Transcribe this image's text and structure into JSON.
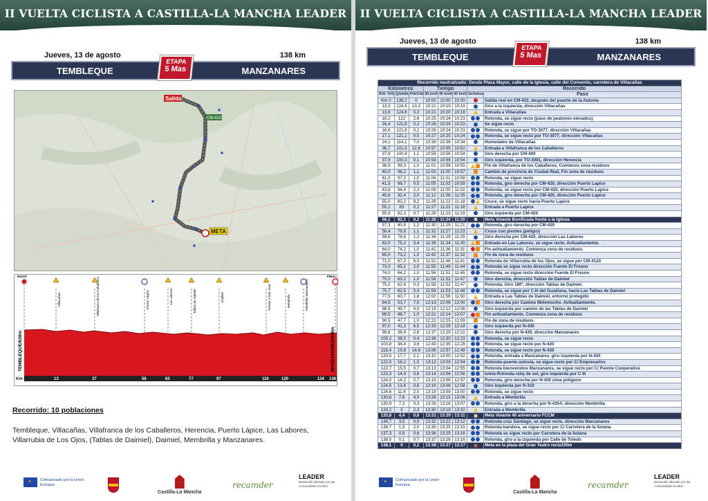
{
  "banner_title": "II VUELTA CICLISTA A CASTILLA-LA MANCHA LEADER",
  "stage": {
    "date": "Jueves, 13 de agosto",
    "distance": "138 km",
    "from": "TEMBLEQUE",
    "to": "MANZANARES",
    "etapa_label": "ETAPA",
    "etapa_value": "5 Mas"
  },
  "map": {
    "start_label": "Salida",
    "finish_label": "META",
    "road_label": "CM-410",
    "places": [
      "Villacañas",
      "Villafranca de los Caballeros",
      "Herencia",
      "Puerto Lápice",
      "Las Labores",
      "Daimiel",
      "Membrilla",
      "Manzanares"
    ]
  },
  "profile": {
    "start_label": "INICIO",
    "end_label": "FINAL",
    "left_axis": "TEMBLEQUE/638m",
    "right_axis": "MANZANARES/648m",
    "km_label": "Km 0",
    "km_ticks": [
      "13",
      "37",
      "56",
      "63",
      "77",
      "97",
      "116",
      "120",
      "134",
      "138"
    ],
    "waypoints": [
      "Villacañas",
      "Villafranca de los Caballeros",
      "Puerto Lápice",
      "Las Labores",
      "Tablas de Daimiel",
      "Daimiel",
      "Arenas a San Juan",
      "Membrilla",
      "Membrilla Manzanares"
    ]
  },
  "recorrido": {
    "title": "Recorrido: 10 poblaciones",
    "text": "Tembleque, Villacañas, Villafranca de los Caballeros, Herencia, Puerto Lápice, Las Labores, Villarrubia de Los Ojos, (Tablas de Daimiel), Daimiel, Membrilla y Manzanares."
  },
  "footer": {
    "eu_text": "Cofinanciado por la Unión Europea",
    "clm_text": "Castilla-La Mancha",
    "recamder": "recamder",
    "leader": "LEADER",
    "leader_sub": "Desarrollo liderado por las comunidades locales"
  },
  "table": {
    "title": "Recorrido neutralizado: Desde Plaza Mayor, calle de la Iglesia, calle del Convento, carretera de Villacañas",
    "group_km": "Kilómetros",
    "group_time": "Tiempo",
    "group_route": "Recorrido",
    "col_total": "Km Total",
    "col_left": "Quedan",
    "col_partial": "Parcial",
    "col_38": "38 km/h",
    "col_40": "40 km/h",
    "col_42": "42 km/h",
    "col_signs": "Señalización",
    "col_route": "Paso",
    "rows": [
      {
        "t": "Km 0",
        "q": "138,2",
        "p": "0",
        "a": "10:00",
        "b": "10:00",
        "c": "10:00",
        "icons": [
          "red"
        ],
        "d": "Salida real en CM-410, después del puente de la Autovía"
      },
      {
        "t": "13,3",
        "q": "124,9",
        "p": "13,3",
        "a": "10:21",
        "b": "10:19",
        "c": "10:19",
        "icons": [
          "blue"
        ],
        "d": "Giro a la izquierda, dirección Villacañas"
      },
      {
        "t": "13,6",
        "q": "124,6",
        "p": "0,3",
        "a": "10:21",
        "b": "10:20",
        "c": "10:19",
        "icons": [
          "tri"
        ],
        "d": "Entrada a Villacañas"
      },
      {
        "t": "16,2",
        "q": "122",
        "p": "2,6",
        "a": "10:25",
        "b": "10:24",
        "c": "10:23",
        "icons": [
          "blue",
          "blue"
        ],
        "d": "Rotonda, se sigue recto (paso de peatones elevados)"
      },
      {
        "t": "16,4",
        "q": "121,8",
        "p": "0,2",
        "a": "10:26",
        "b": "10:24",
        "c": "10:23",
        "icons": [
          "blue"
        ],
        "d": "Se sigue recto"
      },
      {
        "t": "16,6",
        "q": "121,6",
        "p": "0,2",
        "a": "10:26",
        "b": "10:24",
        "c": "10:23",
        "icons": [
          "blue",
          "blue"
        ],
        "d": "Rotonda, se sigue por TO-3077, dirección Villacañas"
      },
      {
        "t": "17,1",
        "q": "121,1",
        "p": "0,5",
        "a": "10:27",
        "b": "10:25",
        "c": "10:24",
        "icons": [
          "blue",
          "blue"
        ],
        "d": "Rotonda, se sigue recto por TO-3077, dirección Villacañas"
      },
      {
        "t": "24,1",
        "q": "114,1",
        "p": "7,0",
        "a": "10:38",
        "b": "10:36",
        "c": "10:34",
        "icons": [
          "blue"
        ],
        "d": "Humedales de Villacañas"
      },
      {
        "t": "36,7",
        "q": "101,5",
        "p": "12,6",
        "a": "10:57",
        "b": "10:55",
        "c": "10:52",
        "icons": [
          "tri"
        ],
        "d": "Entrada a Villafranca de los Caballeros"
      },
      {
        "t": "37,8",
        "q": "100,4",
        "p": "1,1",
        "a": "10:59",
        "b": "10:56",
        "c": "10:54",
        "icons": [
          "blue"
        ],
        "d": "Giro derecha por CM-400"
      },
      {
        "t": "37,9",
        "q": "100,3",
        "p": "0,1",
        "a": "10:59",
        "b": "10:56",
        "c": "10:54",
        "icons": [
          "blue"
        ],
        "d": "Giro izquierda, por TO-3091, dirección Herencia"
      },
      {
        "t": "38,9",
        "q": "99,3",
        "p": "1,0",
        "a": "11:01",
        "b": "10:58",
        "c": "10:55",
        "icons": [
          "tri",
          "orange"
        ],
        "d": "Fin de Villafranca de los Caballeros, Comienzo zona residuos"
      },
      {
        "t": "40,0",
        "q": "98,2",
        "p": "1,1",
        "a": "11:03",
        "b": "11:00",
        "c": "10:57",
        "icons": [
          "orange"
        ],
        "d": "Cambio de provincia de Ciudad Real, Fin zona de residuos"
      },
      {
        "t": "41,0",
        "q": "97,2",
        "p": "1,0",
        "a": "11:04",
        "b": "11:01",
        "c": "10:58",
        "icons": [
          "blue",
          "blue"
        ],
        "d": "Rotonda, se sigue recto"
      },
      {
        "t": "41,5",
        "q": "96,7",
        "p": "0,5",
        "a": "11:05",
        "b": "11:02",
        "c": "10:59",
        "icons": [
          "blue",
          "blue"
        ],
        "d": "Rotonda, giro derecha por CM-420, dirección Puerto Lapice"
      },
      {
        "t": "43,8",
        "q": "94,4",
        "p": "2,3",
        "a": "11:09",
        "b": "11:05",
        "c": "11:02",
        "icons": [
          "blue",
          "blue"
        ],
        "d": "Rotonda, se sigue recto por CM-420, dirección Puerto Lapice"
      },
      {
        "t": "45,8",
        "q": "92,4",
        "p": "2,0",
        "a": "11:12",
        "b": "11:08",
        "c": "11:05",
        "icons": [
          "blue",
          "blue"
        ],
        "d": "Rotonda, giro derecha por CM-420, dirección Puerto Lapice"
      },
      {
        "t": "55,0",
        "q": "83,2",
        "p": "9,2",
        "a": "11:26",
        "b": "11:22",
        "c": "11:18",
        "icons": [
          "blue",
          "tri"
        ],
        "d": "Cruce, se sigue recto hacia Puerto Lapice"
      },
      {
        "t": "55,2",
        "q": "83",
        "p": "0,2",
        "a": "11:27",
        "b": "11:22",
        "c": "11:18",
        "icons": [
          "tri"
        ],
        "d": "Entrada a Puerto Lapice"
      },
      {
        "t": "55,9",
        "q": "82,3",
        "p": "0,7",
        "a": "11:28",
        "b": "11:23",
        "c": "11:19",
        "icons": [
          "blue"
        ],
        "d": "Giro izquierda por CM-420"
      },
      {
        "t": "56,1",
        "q": "82,1",
        "p": "0,2",
        "a": "11:28",
        "b": "11:24",
        "c": "11:20",
        "icons": [
          "cam"
        ],
        "d": "Meta Volante Bonificada frente a la Iglesia",
        "hl": true
      },
      {
        "t": "57,3",
        "q": "80,9",
        "p": "1,2",
        "a": "11:30",
        "b": "11:25",
        "c": "11:21",
        "icons": [
          "blue",
          "blue"
        ],
        "d": "Rotonda, giro derecha por CM-420"
      },
      {
        "t": "58,4",
        "q": "79,8",
        "p": "1,1",
        "a": "11:32",
        "b": "11:27",
        "c": "11:23",
        "icons": [
          "tri"
        ],
        "d": "Cruce con pivotes (peligro)"
      },
      {
        "t": "59,6",
        "q": "78,6",
        "p": "1,2",
        "a": "11:34",
        "b": "11:29",
        "c": "11:25",
        "icons": [
          "blue"
        ],
        "d": "Giro derecha por CM-420, dirección Las Labores"
      },
      {
        "t": "63,0",
        "q": "75,2",
        "p": "3,4",
        "a": "11:39",
        "b": "11:34",
        "c": "11:30",
        "icons": [
          "tri",
          "orange"
        ],
        "d": "Entrada en Las Labores, se sigue recto. Avituallamiento."
      },
      {
        "t": "64,0",
        "q": "74,2",
        "p": "1,0",
        "a": "11:41",
        "b": "11:36",
        "c": "11:31",
        "icons": [
          "red",
          "orange"
        ],
        "d": "Fin avituallamiento. Comienza zona de residuos."
      },
      {
        "t": "65,0",
        "q": "73,2",
        "p": "1,0",
        "a": "11:42",
        "b": "11:37",
        "c": "11:32",
        "icons": [
          "orange"
        ],
        "d": "Fin de zona de residuos"
      },
      {
        "t": "71,0",
        "q": "67,2",
        "p": "6,0",
        "a": "11:52",
        "b": "11:46",
        "c": "11:41",
        "icons": [
          "blue",
          "blue"
        ],
        "d": "Rotonda de Villarrubia de los Ojos, se sigue por CM-4120"
      },
      {
        "t": "73,0",
        "q": "65,2",
        "p": "2,0",
        "a": "11:55",
        "b": "11:49",
        "c": "11:44",
        "icons": [
          "blue",
          "blue"
        ],
        "d": "Rotonda se sigue recto dirección Fuente El Fresno"
      },
      {
        "t": "74,0",
        "q": "64,2",
        "p": "1,0",
        "a": "11:56",
        "b": "11:51",
        "c": "11:45",
        "icons": [
          "blue",
          "blue"
        ],
        "d": "Rotonda, se sigue recto dirección Fuente El Fresno"
      },
      {
        "t": "75,0",
        "q": "63,2",
        "p": "1,0",
        "a": "11:58",
        "b": "11:52",
        "c": "11:47",
        "icons": [
          "blue"
        ],
        "d": "Giro derecha, dirección Tablas de Daimiel"
      },
      {
        "t": "75,2",
        "q": "62,9",
        "p": "0,3",
        "a": "11:58",
        "b": "11:52",
        "c": "11:47",
        "icons": [
          "blue"
        ],
        "d": "Rotonda, Giro 180º, dirección Tablas de Daimiel."
      },
      {
        "t": "75,7",
        "q": "62,5",
        "p": "0,4",
        "a": "11:59",
        "b": "11:53",
        "c": "11:48",
        "icons": [
          "blue",
          "blue"
        ],
        "d": "Rotonda, se sigue por C.N del Guadiana, hacia Las Tablas de Daimiel"
      },
      {
        "t": "77,5",
        "q": "60,7",
        "p": "1,8",
        "a": "12:02",
        "b": "11:56",
        "c": "11:50",
        "icons": [
          "tri"
        ],
        "d": "Entrada a Las Tablas de Daimiel, entorno protegido"
      },
      {
        "t": "84,5",
        "q": "53,7",
        "p": "7,0",
        "a": "12:13",
        "b": "12:06",
        "c": "12:00",
        "icons": [
          "blue",
          "orange"
        ],
        "d": "Giro derecha por Camino Molemocho. Avituallamiento."
      },
      {
        "t": "88,5",
        "q": "49,7",
        "p": "4,0",
        "a": "12:19",
        "b": "12:12",
        "c": "12:06",
        "icons": [
          "blue"
        ],
        "d": "Giro izquierda por camino de las Tablas de Daimiel"
      },
      {
        "t": "89,5",
        "q": "48,7",
        "p": "1,0",
        "a": "12:21",
        "b": "12:14",
        "c": "12:07",
        "icons": [
          "red",
          "orange"
        ],
        "d": "Fin avituallamiento. Comienza zona de residuos"
      },
      {
        "t": "90,5",
        "q": "47,7",
        "p": "1,0",
        "a": "12:22",
        "b": "12:15",
        "c": "12:09",
        "icons": [
          "orange"
        ],
        "d": "Fin de zona de residuos"
      },
      {
        "t": "97,0",
        "q": "41,2",
        "p": "6,5",
        "a": "12:33",
        "b": "12:25",
        "c": "12:18",
        "icons": [
          "blue"
        ],
        "d": "Giro izquierda por N-430"
      },
      {
        "t": "99,8",
        "q": "38,4",
        "p": "2,8",
        "a": "12:37",
        "b": "12:29",
        "c": "12:22",
        "icons": [
          "blue"
        ],
        "d": "Giro derecha por N-430, dirección Manzanares"
      },
      {
        "t": "100,2",
        "q": "38,0",
        "p": "0,4",
        "a": "12:38",
        "b": "12:30",
        "c": "12:23",
        "icons": [
          "blue",
          "blue"
        ],
        "d": "Rotonda, se sigue recto"
      },
      {
        "t": "103,8",
        "q": "34,4",
        "p": "3,6",
        "a": "12:43",
        "b": "12:35",
        "c": "12:28",
        "icons": [
          "blue",
          "blue"
        ],
        "d": "Rotonda, se sigue recto por N-430"
      },
      {
        "t": "118,4",
        "q": "19,8",
        "p": "14,6",
        "a": "13:06",
        "b": "12:57",
        "c": "12:49",
        "icons": [
          "blue",
          "blue"
        ],
        "d": "Rotonda, se sigue recto por N-430"
      },
      {
        "t": "120,5",
        "q": "17,7",
        "p": "2,1",
        "a": "13:10",
        "b": "13:00",
        "c": "12:52",
        "icons": [
          "blue",
          "blue"
        ],
        "d": "Rotonda, entrada a Manzanares, giro izquierda por N-430"
      },
      {
        "t": "122,0",
        "q": "16,2",
        "p": "1,5",
        "a": "13:12",
        "b": "13:03",
        "c": "12:54",
        "icons": [
          "blue",
          "blue"
        ],
        "d": "Rotonda-puente autovía, se sigue recto por C/ Empresarios"
      },
      {
        "t": "122,7",
        "q": "15,5",
        "p": "0,7",
        "a": "13:13",
        "b": "13:04",
        "c": "12:55",
        "icons": [
          "blue",
          "blue"
        ],
        "d": "Rotonda bienvenidos Manzanares, se sigue recto por C/ Puente Cooperativa"
      },
      {
        "t": "123,3",
        "q": "14,9",
        "p": "0,6",
        "a": "13:14",
        "b": "13:04",
        "c": "12:56",
        "icons": [
          "blue",
          "blue"
        ],
        "d": "Isleta-Rotonda reloj de sol, giro izquierda por C III"
      },
      {
        "t": "124,0",
        "q": "14,2",
        "p": "0,7",
        "a": "13:15",
        "b": "13:06",
        "c": "12:57",
        "icons": [
          "blue",
          "blue"
        ],
        "d": "Rotonda, giro derecha por N-430 zona polígono"
      },
      {
        "t": "124,6",
        "q": "13,6",
        "p": "0,6",
        "a": "13:16",
        "b": "13:06",
        "c": "12:58",
        "icons": [
          "blue"
        ],
        "d": "Giro Izquierda por N-310"
      },
      {
        "t": "126,6",
        "q": "11,6",
        "p": "2,0",
        "a": "13:19",
        "b": "13:09",
        "c": "13:00",
        "icons": [
          "blue",
          "blue"
        ],
        "d": "Rotonda, se sigue recto"
      },
      {
        "t": "130,6",
        "q": "7,6",
        "p": "4,0",
        "a": "13:26",
        "b": "13:15",
        "c": "13:06",
        "icons": [
          "tri"
        ],
        "d": "Entrada a Membrilla"
      },
      {
        "t": "130,9",
        "q": "7,3",
        "p": "0,3",
        "a": "13:26",
        "b": "13:16",
        "c": "13:07",
        "icons": [
          "blue",
          "blue"
        ],
        "d": "Rotonda, giro a la derecha por N-430A, dirección Membrilla"
      },
      {
        "t": "133,2",
        "q": "5",
        "p": "2,3",
        "a": "13:30",
        "b": "13:19",
        "c": "13:10",
        "icons": [
          "tri"
        ],
        "d": "Entrada a Membrilla"
      },
      {
        "t": "133,8",
        "q": "4,4",
        "p": "0,6",
        "a": "13:31",
        "b": "13:20",
        "c": "13:11",
        "icons": [
          "cam"
        ],
        "d": "Meta Volante 40 aniversario FCCM",
        "hl": true
      },
      {
        "t": "134,7",
        "q": "3,5",
        "p": "0,9",
        "a": "13:32",
        "b": "13:22",
        "c": "13:12",
        "icons": [
          "blue",
          "blue"
        ],
        "d": "Rotonda cruz Santiago, se sigue recto, dirección Manzanares"
      },
      {
        "t": "136,7",
        "q": "1,5",
        "p": "2,0",
        "a": "13:35",
        "b": "13:25",
        "c": "13:15",
        "icons": [
          "blue",
          "blue"
        ],
        "d": "Rotonda bandera, se sigue recto por C/ Carretera de la Solana"
      },
      {
        "t": "137,3",
        "q": "0,9",
        "p": "0,6",
        "a": "13:36",
        "b": "13:25",
        "c": "13:16",
        "icons": [
          "blue",
          "blue"
        ],
        "d": "Rotonda se sigue recto por Carretera de la Solana"
      },
      {
        "t": "138,0",
        "q": "0,1",
        "p": "0,7",
        "a": "13:37",
        "b": "13:26",
        "c": "13:16",
        "icons": [
          "blue",
          "blue"
        ],
        "d": "Rotonda, giro a la izquierda por Calle de Toledo"
      },
      {
        "t": "138,1",
        "q": "0",
        "p": "0,2",
        "a": "13:38",
        "b": "13:27",
        "c": "13:17",
        "icons": [
          "flag"
        ],
        "d": "Meta en la plaza del Gran Teatro recta100m",
        "hl": true
      }
    ]
  }
}
